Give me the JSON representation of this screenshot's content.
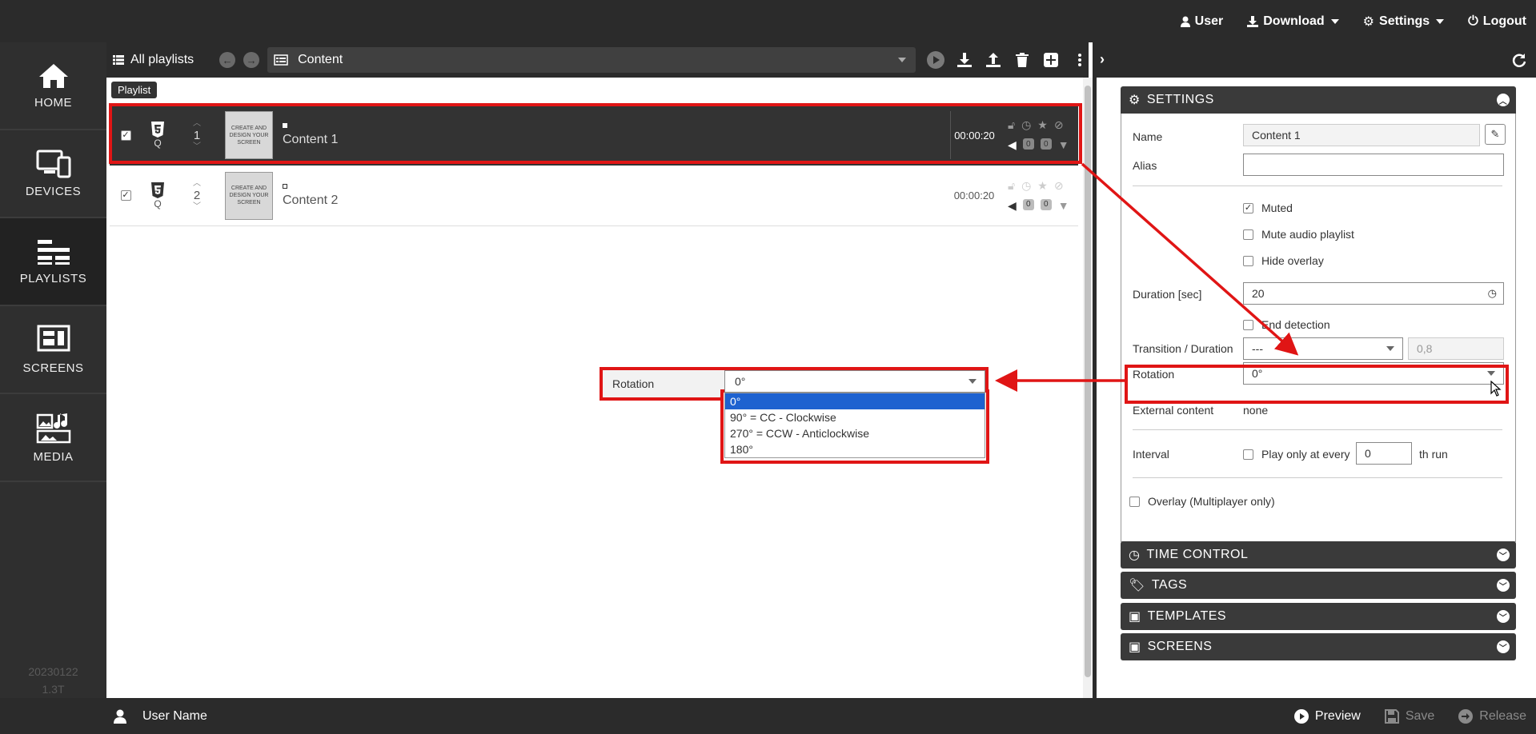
{
  "topnav": {
    "user": "User",
    "download": "Download",
    "settings": "Settings",
    "logout": "Logout"
  },
  "sidenav": {
    "items": [
      {
        "label": "HOME",
        "icon": "home-icon"
      },
      {
        "label": "DEVICES",
        "icon": "devices-icon"
      },
      {
        "label": "PLAYLISTS",
        "icon": "playlists-icon"
      },
      {
        "label": "SCREENS",
        "icon": "screens-icon"
      },
      {
        "label": "MEDIA",
        "icon": "media-icon"
      }
    ],
    "active": "PLAYLISTS",
    "version_line1": "20230122",
    "version_line2": "1.3T"
  },
  "toolbar": {
    "all_playlists": "All playlists",
    "content_select": "Content"
  },
  "playlist": {
    "tab_label": "Playlist",
    "rows": [
      {
        "index": "1",
        "type_letter": "Q",
        "thumb_text": "CREATE AND DESIGN YOUR SCREEN",
        "title": "Content 1",
        "duration": "00:00:20",
        "count_a": "0",
        "count_b": "0",
        "selected": true
      },
      {
        "index": "2",
        "type_letter": "Q",
        "thumb_text": "CREATE AND DESIGN YOUR SCREEN",
        "title": "Content 2",
        "duration": "00:00:20",
        "count_a": "0",
        "count_b": "0",
        "selected": false
      }
    ]
  },
  "rotation_callout": {
    "label": "Rotation",
    "value": "0°",
    "options": [
      "0°",
      "90° = CC - Clockwise",
      "270° = CCW - Anticlockwise",
      "180°"
    ],
    "highlighted": "0°"
  },
  "settings_panel": {
    "title": "SETTINGS",
    "name_label": "Name",
    "name_value": "Content 1",
    "alias_label": "Alias",
    "alias_value": "",
    "muted_label": "Muted",
    "mute_audio_label": "Mute audio playlist",
    "hide_overlay_label": "Hide overlay",
    "duration_label": "Duration [sec]",
    "duration_value": "20",
    "end_detection_label": "End detection",
    "transition_label": "Transition / Duration",
    "transition_value": "---",
    "transition_duration": "0,8",
    "rotation_label": "Rotation",
    "rotation_value": "0°",
    "external_label": "External content",
    "external_value": "none",
    "interval_label": "Interval",
    "interval_checkbox_label": "Play only at every",
    "interval_value": "0",
    "interval_suffix": "th run",
    "overlay_label": "Overlay (Multiplayer only)"
  },
  "collapsed_panels": [
    {
      "title": "TIME CONTROL",
      "icon": "clock-icon"
    },
    {
      "title": "TAGS",
      "icon": "tags-icon"
    },
    {
      "title": "TEMPLATES",
      "icon": "templates-icon"
    },
    {
      "title": "SCREENS",
      "icon": "screens-icon"
    }
  ],
  "bottombar": {
    "user_name": "User Name",
    "preview": "Preview",
    "save": "Save",
    "release": "Release"
  },
  "colors": {
    "dark_bar": "#2b2b2b",
    "annotation_red": "#e01515",
    "highlight_blue": "#1e62d0"
  }
}
